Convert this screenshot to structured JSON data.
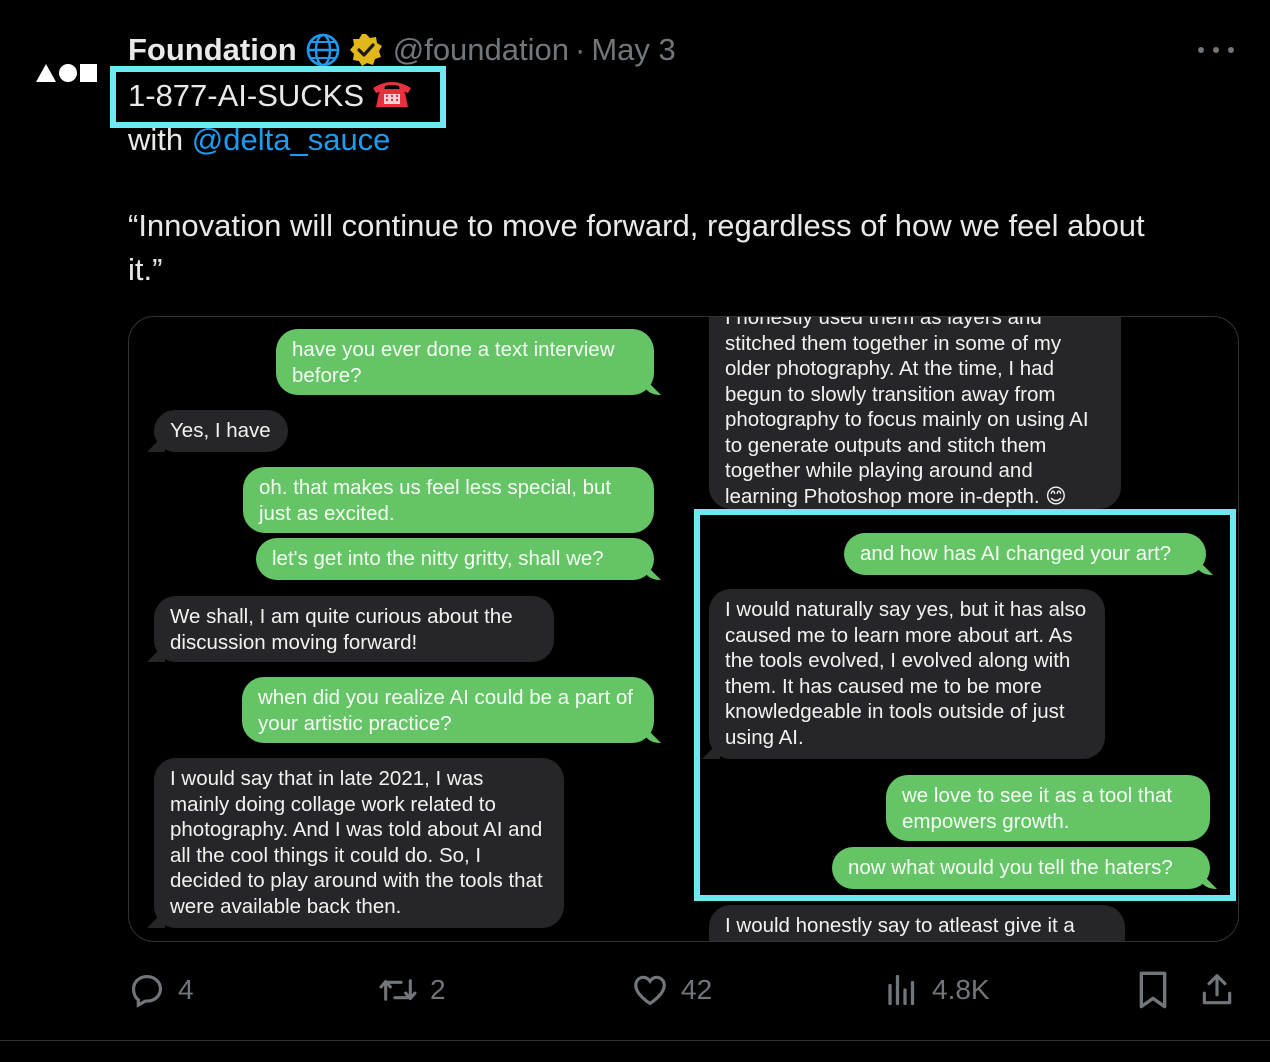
{
  "author": {
    "display_name": "Foundation",
    "handle": "@foundation",
    "separator": "·",
    "date": "May 3",
    "avatar_icon": "foundation-logo-icon",
    "badges": [
      "globe-icon",
      "verified-gold-icon"
    ]
  },
  "tweet": {
    "headline": "1-877-AI-SUCKS",
    "headline_icon": "telephone-icon",
    "with_prefix": "with",
    "mention": "@delta_sauce",
    "quote_line1": "“Innovation will continue to move forward, regardless of how we feel about",
    "quote_line2": "it.”"
  },
  "media": {
    "left_column": [
      {
        "type": "sent",
        "text": "have you ever done a text interview before?"
      },
      {
        "type": "received",
        "text": "Yes, I have"
      },
      {
        "type": "sent",
        "text": "oh. that makes us feel less special, but just as excited."
      },
      {
        "type": "sent",
        "text": "let's get into the nitty gritty, shall we?"
      },
      {
        "type": "received",
        "text": "We shall, I am quite curious about the discussion moving forward!"
      },
      {
        "type": "sent",
        "text": "when did you realize AI could be a part of your artistic practice?"
      },
      {
        "type": "received",
        "text": "I would say that in late 2021, I was mainly doing collage work related to photography. And I was told about AI and all the cool things it could do. So, I decided to play around with the tools that were available back then."
      }
    ],
    "right_column": [
      {
        "type": "received",
        "text": "I honestly used them as layers and stitched them together in some of my older photography. At the time, I had begun to slowly transition away from photography to focus mainly on using AI to generate outputs and stitch them together while playing around and learning Photoshop more in-depth. 😊"
      },
      {
        "type": "sent",
        "text": "and how has AI changed your art?"
      },
      {
        "type": "received",
        "text": "I would naturally say yes, but it has also caused me to learn more about art. As the tools evolved, I evolved along with them. It has caused me to be more knowledgeable in tools outside of just using AI."
      },
      {
        "type": "sent",
        "text": "we love to see it as a tool that empowers growth."
      },
      {
        "type": "sent",
        "text": "now what would you tell the haters?"
      },
      {
        "type": "received",
        "text": "I would honestly say to atleast give it a"
      }
    ]
  },
  "actions": {
    "replies": "4",
    "reposts": "2",
    "likes": "42",
    "views": "4.8K",
    "icons": [
      "reply-icon",
      "repost-icon",
      "like-icon",
      "views-icon",
      "bookmark-icon",
      "share-icon"
    ]
  },
  "colors": {
    "background": "#000000",
    "highlight": "#6ee9f2",
    "link": "#1d9bf0",
    "imessage_green": "#65c466",
    "received_gray": "#262628",
    "muted": "#71767b"
  }
}
